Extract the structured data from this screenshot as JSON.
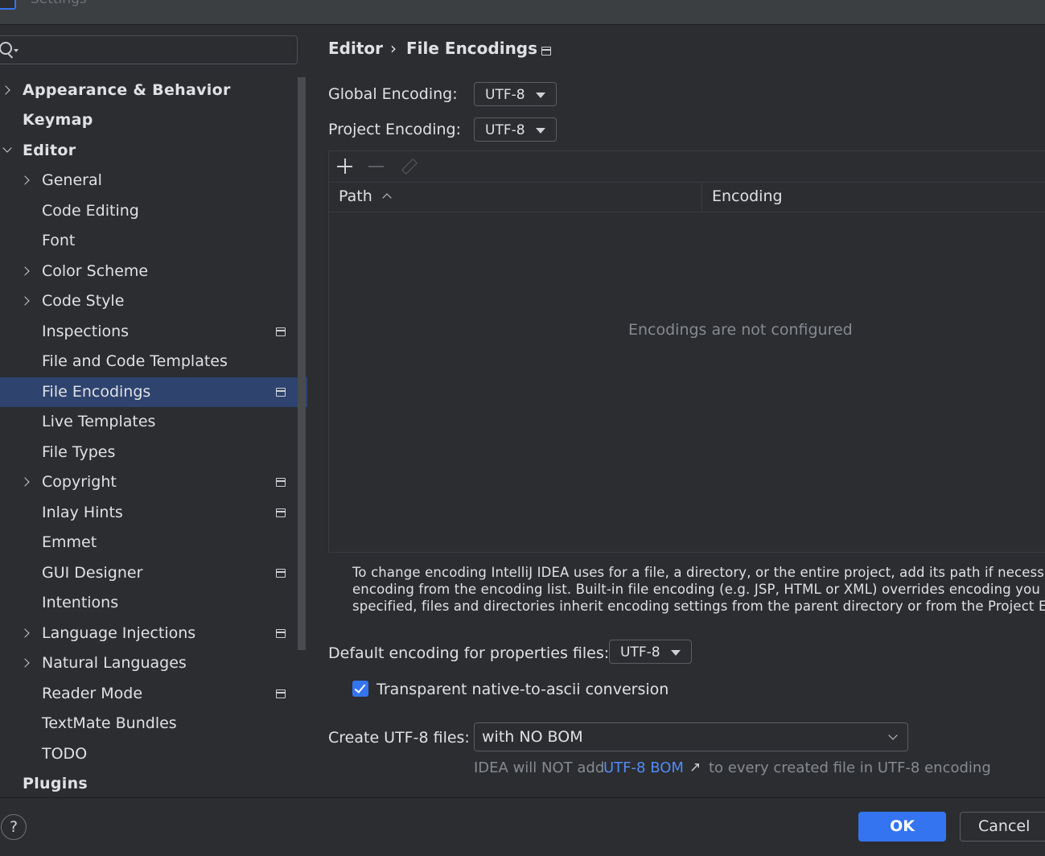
{
  "window": {
    "title": "Settings"
  },
  "sidebar": {
    "search_placeholder": "",
    "items": [
      {
        "label": "Appearance & Behavior"
      },
      {
        "label": "Keymap"
      },
      {
        "label": "Editor"
      },
      {
        "label": "General"
      },
      {
        "label": "Code Editing"
      },
      {
        "label": "Font"
      },
      {
        "label": "Color Scheme"
      },
      {
        "label": "Code Style"
      },
      {
        "label": "Inspections"
      },
      {
        "label": "File and Code Templates"
      },
      {
        "label": "File Encodings"
      },
      {
        "label": "Live Templates"
      },
      {
        "label": "File Types"
      },
      {
        "label": "Copyright"
      },
      {
        "label": "Inlay Hints"
      },
      {
        "label": "Emmet"
      },
      {
        "label": "GUI Designer"
      },
      {
        "label": "Intentions"
      },
      {
        "label": "Language Injections"
      },
      {
        "label": "Natural Languages"
      },
      {
        "label": "Reader Mode"
      },
      {
        "label": "TextMate Bundles"
      },
      {
        "label": "TODO"
      },
      {
        "label": "Plugins"
      }
    ],
    "selected": "File Encodings"
  },
  "breadcrumb": {
    "parent": "Editor",
    "separator": "›",
    "current": "File Encodings"
  },
  "global_encoding": {
    "label": "Global Encoding:",
    "value": "UTF-8"
  },
  "project_encoding": {
    "label": "Project Encoding:",
    "value": "UTF-8"
  },
  "table": {
    "columns": [
      "Path",
      "Encoding"
    ],
    "sort_column": "Path",
    "sort_direction": "ascending",
    "rows": [],
    "empty_text": "Encodings are not configured"
  },
  "help_text": {
    "line1": "To change encoding IntelliJ IDEA uses for a file, a directory, or the entire project, add its path if necessary an",
    "line2": "encoding from the encoding list. Built-in file encoding (e.g. JSP, HTML or XML) overrides encoding you speci",
    "line3": "specified, files and directories inherit encoding settings from the parent directory or from the Project Encodin"
  },
  "properties_encoding": {
    "label": "Default encoding for properties files:",
    "value": "UTF-8"
  },
  "native_to_ascii": {
    "label": "Transparent native-to-ascii conversion",
    "checked": true
  },
  "create_utf8": {
    "label": "Create UTF-8 files:",
    "value": "with NO BOM"
  },
  "bom_note": {
    "prefix": "IDEA will NOT add",
    "link": "UTF-8 BOM",
    "suffix": "to every created file in UTF-8 encoding"
  },
  "footer": {
    "help": "?",
    "ok": "OK",
    "cancel": "Cancel"
  },
  "colors": {
    "accent": "#3574f0",
    "selection": "#2e436e",
    "link": "#548af7",
    "background": "#2b2d30"
  }
}
